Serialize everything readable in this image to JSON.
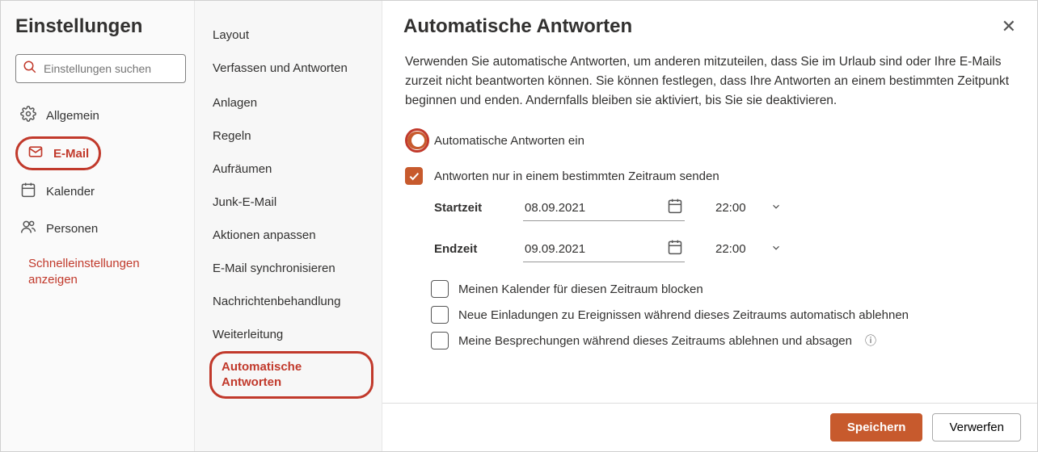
{
  "left": {
    "title": "Einstellungen",
    "search_placeholder": "Einstellungen suchen",
    "categories": {
      "general": "Allgemein",
      "email": "E-Mail",
      "calendar": "Kalender",
      "people": "Personen"
    },
    "quick_link": "Schnelleinstellungen anzeigen"
  },
  "mid": {
    "items": {
      "layout": "Layout",
      "compose": "Verfassen und Antworten",
      "attachments": "Anlagen",
      "rules": "Regeln",
      "sweep": "Aufräumen",
      "junk": "Junk-E-Mail",
      "custom_actions": "Aktionen anpassen",
      "sync": "E-Mail synchronisieren",
      "handling": "Nachrichtenbehandlung",
      "forwarding": "Weiterleitung",
      "autoreply": "Automatische Antworten"
    }
  },
  "right": {
    "title": "Automatische Antworten",
    "intro": "Verwenden Sie automatische Antworten, um anderen mitzuteilen, dass Sie im Urlaub sind oder Ihre E-Mails zurzeit nicht  beantworten können. Sie können festlegen, dass Ihre Antworten an einem bestimmten Zeitpunkt beginnen und enden. Andernfalls  bleiben sie aktiviert, bis Sie sie deaktivieren.",
    "toggle_label": "Automatische Antworten ein",
    "timerange_label": "Antworten nur in einem bestimmten Zeitraum senden",
    "start_label": "Startzeit",
    "end_label": "Endzeit",
    "start_date": "08.09.2021",
    "start_time": "22:00",
    "end_date": "09.09.2021",
    "end_time": "22:00",
    "opts": {
      "block_cal": "Meinen Kalender für diesen Zeitraum blocken",
      "decline_new": "Neue Einladungen zu Ereignissen während dieses Zeitraums automatisch ablehnen",
      "cancel_meet": "Meine Besprechungen während dieses Zeitraums ablehnen und absagen"
    },
    "buttons": {
      "save": "Speichern",
      "discard": "Verwerfen"
    }
  }
}
